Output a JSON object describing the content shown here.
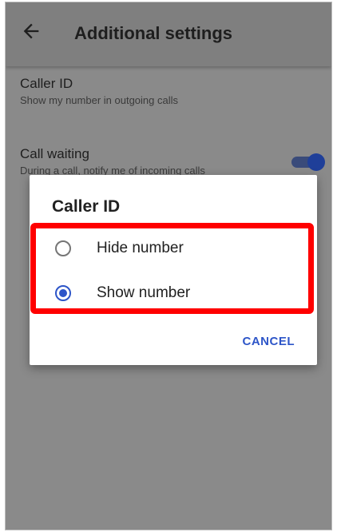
{
  "appbar": {
    "title": "Additional settings",
    "back_icon": "arrow-back-icon"
  },
  "settings": [
    {
      "title": "Caller ID",
      "subtitle": "Show my number in outgoing calls"
    },
    {
      "title": "Call waiting",
      "subtitle": "During a call, notify me of incoming calls"
    }
  ],
  "call_waiting_toggle": {
    "state": "on"
  },
  "dialog": {
    "title": "Caller ID",
    "options": [
      {
        "label": "Hide number",
        "selected": false
      },
      {
        "label": "Show number",
        "selected": true
      }
    ],
    "cancel_label": "CANCEL"
  },
  "colors": {
    "accent": "#2d55c8",
    "highlight": "#ff0000",
    "radio_selected": "#2d55c8",
    "radio_unselected": "#757575"
  }
}
